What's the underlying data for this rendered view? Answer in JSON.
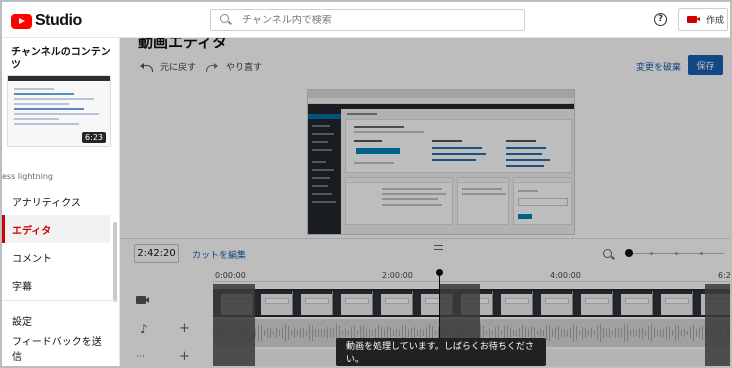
{
  "app": {
    "logo_text": "Studio",
    "search_placeholder": "チャンネル内で検索",
    "help_icon": "help-circle-icon",
    "create_label": "作成",
    "brand_color": "#ff0000"
  },
  "sidebar": {
    "title": "チャンネルのコンテンツ",
    "thumbnail_duration": "6:23",
    "channel_name": "ess lightning",
    "items": [
      {
        "label": "アナリティクス",
        "active": false
      },
      {
        "label": "エディタ",
        "active": true
      },
      {
        "label": "コメント",
        "active": false
      },
      {
        "label": "字幕",
        "active": false
      }
    ],
    "bottom_items": [
      {
        "label": "設定"
      },
      {
        "label": "フィードバックを送信"
      }
    ]
  },
  "editor": {
    "title": "動画エディタ",
    "undo_label": "元に戻す",
    "redo_label": "やり直す",
    "discard_label": "変更を破棄",
    "save_label": "保存",
    "accent_color": "#1a5fb4"
  },
  "timeline": {
    "current_time": "2:42:20",
    "cut_label": "カットを編集",
    "ruler_labels": [
      "0:00:00",
      "2:00:00",
      "4:00:00",
      "6:2"
    ]
  },
  "toast": {
    "message": "動画を処理しています。しばらくお待ちください。"
  }
}
